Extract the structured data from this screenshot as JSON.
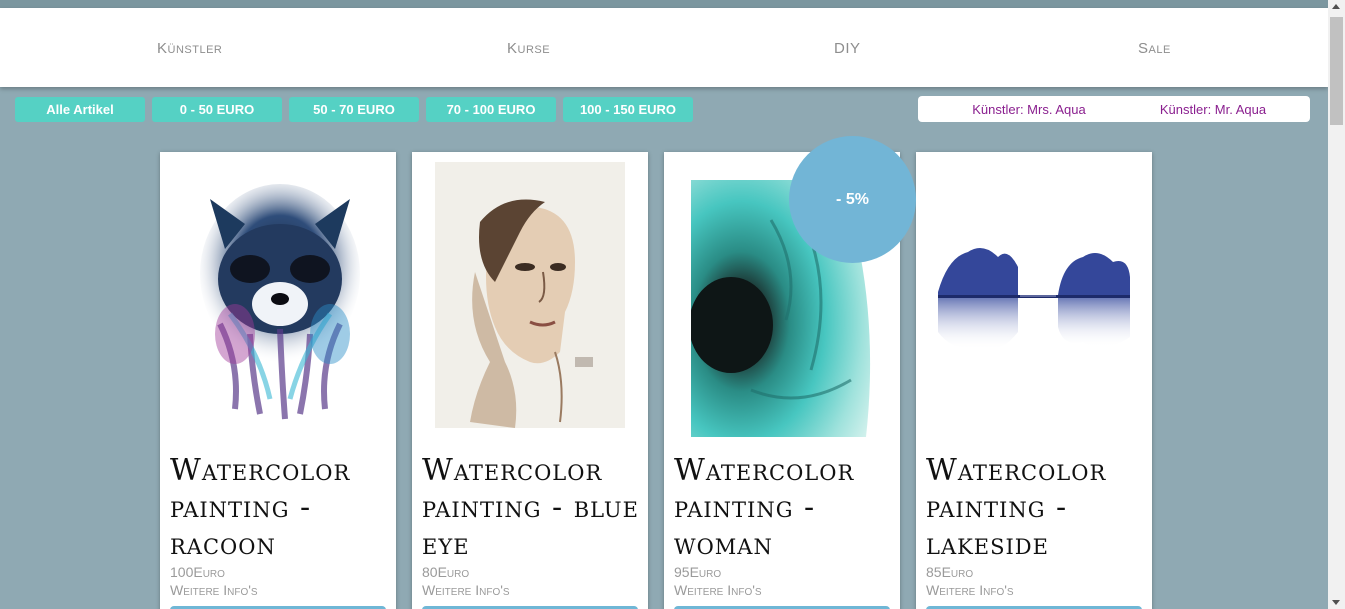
{
  "nav": {
    "items": [
      "Künstler",
      "Kurse",
      "DIY",
      "Sale"
    ]
  },
  "filters": {
    "price": [
      "Alle Artikel",
      "0 - 50 EURO",
      "50 - 70 EURO",
      "70 - 100 EURO",
      "100 - 150 EURO"
    ],
    "artists": [
      "Künstler: Mrs. Aqua",
      "Künstler: Mr. Aqua"
    ]
  },
  "products": [
    {
      "title": "Watercolor painting - racoon",
      "price": "100Euro",
      "info": "Weitere Info's",
      "image_icon": "racoon-painting"
    },
    {
      "title": "Watercolor painting - blue eye",
      "price": "80Euro",
      "info": "Weitere Info's",
      "image_icon": "woman-portrait-painting"
    },
    {
      "title": "Watercolor painting - woman",
      "price": "95Euro",
      "info": "Weitere Info's",
      "image_icon": "eye-painting"
    },
    {
      "title": "Watercolor painting - lakeside",
      "price": "85Euro",
      "info": "Weitere Info's",
      "image_icon": "lakeside-painting"
    }
  ],
  "sale_badge": "- 5%",
  "colors": {
    "background": "#8fa9b3",
    "filter_button": "#55d1c4",
    "artist_text": "#8a1f8f",
    "badge": "#72b5d6",
    "buy_button": "#6fb7d6"
  }
}
